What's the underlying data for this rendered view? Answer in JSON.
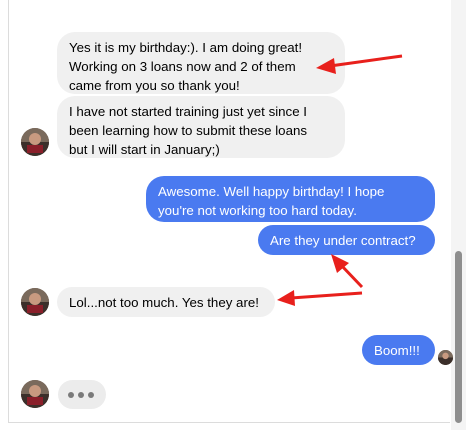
{
  "messages": {
    "m1": "Yes it is my birthday:). I am doing great!\nWorking on 3 loans now and 2 of them\ncame from you so thank you!",
    "m2": "I have not started training just yet since I\nbeen learning how to submit these loans\nbut I will start in January;)",
    "m3": "Awesome.  Well happy birthday!  I hope\nyou're not working too hard today.",
    "m4": "Are they under contract?",
    "m5": "Lol...not too much. Yes they are!",
    "m6": "Boom!!!"
  },
  "colors": {
    "incoming_bubble": "#f0f0f0",
    "outgoing_bubble": "#4a7af0",
    "annotation_arrow": "#e8201c"
  },
  "icons": {
    "typing": "typing-dots-icon",
    "arrow": "red-arrow-annotation"
  }
}
